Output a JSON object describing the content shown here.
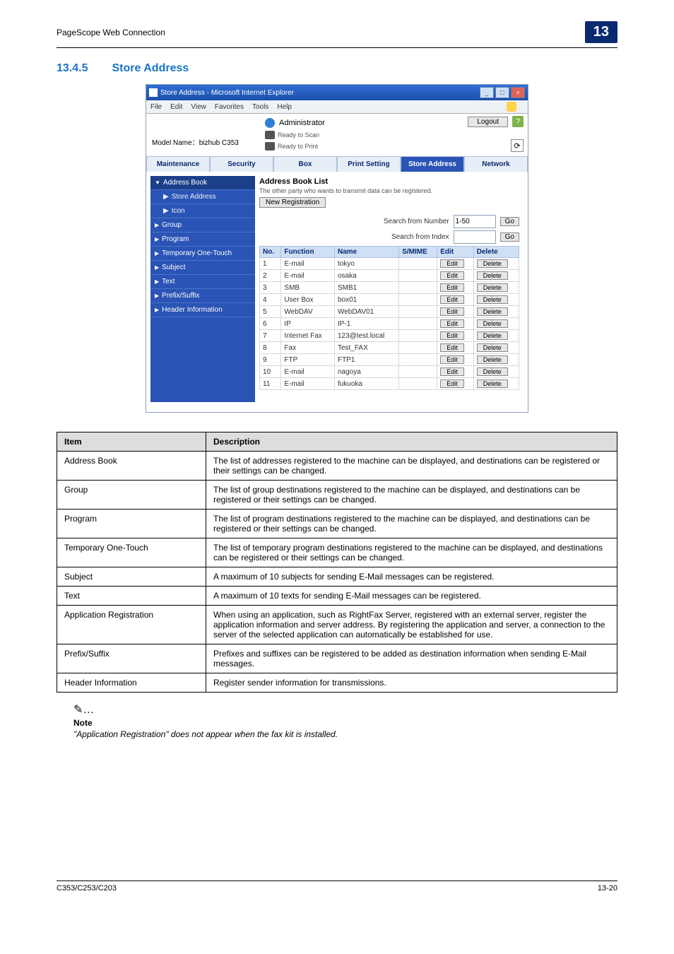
{
  "header": {
    "name": "PageScope Web Connection",
    "badge": "13"
  },
  "section": {
    "num": "13.4.5",
    "title": "Store Address"
  },
  "browser": {
    "title": "Store Address - Microsoft Internet Explorer",
    "menus": [
      "File",
      "Edit",
      "View",
      "Favorites",
      "Tools",
      "Help"
    ],
    "admin": "Administrator",
    "model": "Model Name：bizhub C353",
    "status1": "Ready to Scan",
    "status2": "Ready to Print",
    "logout": "Logout",
    "tabs": [
      "Maintenance",
      "Security",
      "Box",
      "Print Setting",
      "Store Address",
      "Network"
    ],
    "side": {
      "head": "Address Book",
      "sub1": "Store Address",
      "sub2": "Icon",
      "items": [
        "Group",
        "Program",
        "Temporary One-Touch",
        "Subject",
        "Text",
        "Prefix/Suffix",
        "Header Information"
      ]
    },
    "main": {
      "title": "Address Book List",
      "note": "The other party who wants to transmit data can be registered.",
      "new_reg": "New Registration",
      "search_num": "Search from Number",
      "search_num_val": "1-50",
      "search_idx": "Search from Index",
      "go": "Go",
      "cols": [
        "No.",
        "Function",
        "Name",
        "S/MIME",
        "Edit",
        "Delete"
      ],
      "edit": "Edit",
      "del": "Delete",
      "rows": [
        {
          "n": "1",
          "f": "E-mail",
          "name": "tokyo"
        },
        {
          "n": "2",
          "f": "E-mail",
          "name": "osaka"
        },
        {
          "n": "3",
          "f": "SMB",
          "name": "SMB1"
        },
        {
          "n": "4",
          "f": "User Box",
          "name": "box01"
        },
        {
          "n": "5",
          "f": "WebDAV",
          "name": "WebDAV01"
        },
        {
          "n": "6",
          "f": "IP",
          "name": "IP-1"
        },
        {
          "n": "7",
          "f": "Internet Fax",
          "name": "123@test.local"
        },
        {
          "n": "8",
          "f": "Fax",
          "name": "Test_FAX"
        },
        {
          "n": "9",
          "f": "FTP",
          "name": "FTP1"
        },
        {
          "n": "10",
          "f": "E-mail",
          "name": "nagoya"
        },
        {
          "n": "11",
          "f": "E-mail",
          "name": "fukuoka"
        }
      ]
    }
  },
  "table": {
    "head": {
      "item": "Item",
      "desc": "Description"
    },
    "rows": [
      {
        "i": "Address Book",
        "d": "The list of addresses registered to the machine can be displayed, and destinations can be registered or their settings can be changed."
      },
      {
        "i": "Group",
        "d": "The list of group destinations registered to the machine can be displayed, and destinations can be registered or their settings can be changed."
      },
      {
        "i": "Program",
        "d": "The list of program destinations registered to the machine can be displayed, and destinations can be registered or their settings can be changed."
      },
      {
        "i": "Temporary One-Touch",
        "d": "The list of temporary program destinations registered to the machine can be displayed, and destinations can be registered or their settings can be changed."
      },
      {
        "i": "Subject",
        "d": "A maximum of 10 subjects for sending E-Mail messages can be registered."
      },
      {
        "i": "Text",
        "d": "A maximum of 10 texts for sending E-Mail messages can be registered."
      },
      {
        "i": "Application Registration",
        "d": "When using an application, such as RightFax Server, registered with an external server, register the application information and server address. By registering the application and server, a connection to the server of the selected application can automatically be established for use."
      },
      {
        "i": "Prefix/Suffix",
        "d": "Prefixes and suffixes can be registered to be added as destination information when sending E-Mail messages."
      },
      {
        "i": "Header Information",
        "d": "Register sender information for transmissions."
      }
    ]
  },
  "note": {
    "icon": "✎…",
    "title": "Note",
    "text": "\"Application Registration\" does not appear when the fax kit is installed."
  },
  "footer": {
    "left": "C353/C253/C203",
    "right": "13-20"
  }
}
